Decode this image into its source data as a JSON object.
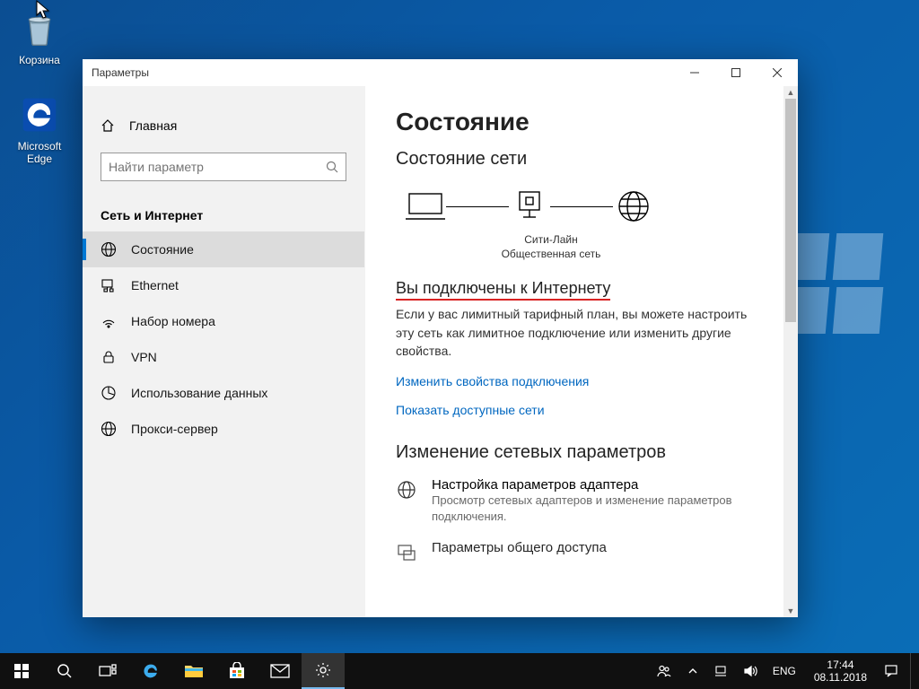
{
  "desktop": {
    "recycle_label": "Корзина",
    "edge_label": "Microsoft Edge"
  },
  "window": {
    "title": "Параметры",
    "home": "Главная",
    "search_placeholder": "Найти параметр",
    "section": "Сеть и Интернет",
    "nav": [
      {
        "label": "Состояние"
      },
      {
        "label": "Ethernet"
      },
      {
        "label": "Набор номера"
      },
      {
        "label": "VPN"
      },
      {
        "label": "Использование данных"
      },
      {
        "label": "Прокси-сервер"
      }
    ]
  },
  "main": {
    "h1": "Состояние",
    "h2": "Состояние сети",
    "net_name": "Сити-Лайн",
    "net_type": "Общественная сеть",
    "connected_heading": "Вы подключены к Интернету",
    "connected_body": "Если у вас лимитный тарифный план, вы можете настроить эту сеть как лимитное подключение или изменить другие свойства.",
    "link_props": "Изменить свойства подключения",
    "link_show": "Показать доступные сети",
    "h3": "Изменение сетевых параметров",
    "opt1_title": "Настройка параметров адаптера",
    "opt1_desc": "Просмотр сетевых адаптеров и изменение параметров подключения.",
    "opt2_title": "Параметры общего доступа"
  },
  "taskbar": {
    "lang": "ENG",
    "time": "17:44",
    "date": "08.11.2018"
  }
}
